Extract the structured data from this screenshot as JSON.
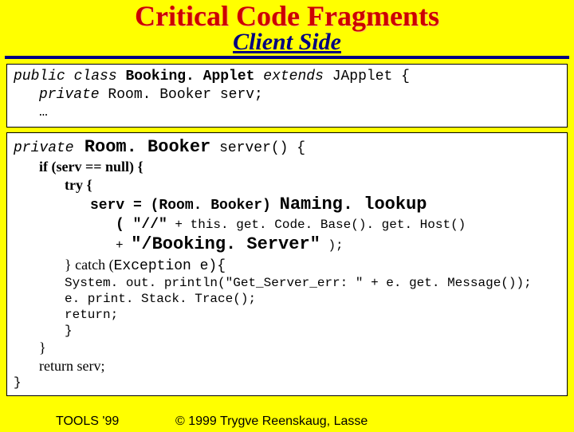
{
  "title": "Critical Code Fragments",
  "subtitle": "Client Side",
  "box1": {
    "line1": {
      "kw_public": "public",
      "kw_class": " class ",
      "name": "Booking. Applet",
      "kw_extends": " extends",
      "tail": " JApplet {"
    },
    "line2": {
      "kw_private": "private",
      "tail": " Room. Booker serv;"
    },
    "line3": "…"
  },
  "box2": {
    "line1": {
      "kw_private": "private",
      "type": " Room. Booker",
      "tail": " server() {"
    },
    "line2": "if (serv == null) {",
    "line3": "try {",
    "line4": {
      "lead": "serv = (Room. Booker) ",
      "call": "Naming. lookup"
    },
    "line5": {
      "lead": "( \"//\"",
      "tail": " + this. get. Code. Base(). get. Host()"
    },
    "line6": {
      "lead": "+ ",
      "str": "\"/Booking. Server\"",
      "tail": " );"
    },
    "line7": {
      "serif": "} catch (",
      "mono": "Exception e){"
    },
    "line8": "System. out. println(\"Get_Server_err: \" + e. get. Message());",
    "line9": "e. print. Stack. Trace();",
    "line10": "return;",
    "line11": "}",
    "line12": "}",
    "line13": "return serv;",
    "line14": "}"
  },
  "footer": {
    "left": "TOOLS '99",
    "right": "© 1999 Trygve Reenskaug, Lasse"
  }
}
